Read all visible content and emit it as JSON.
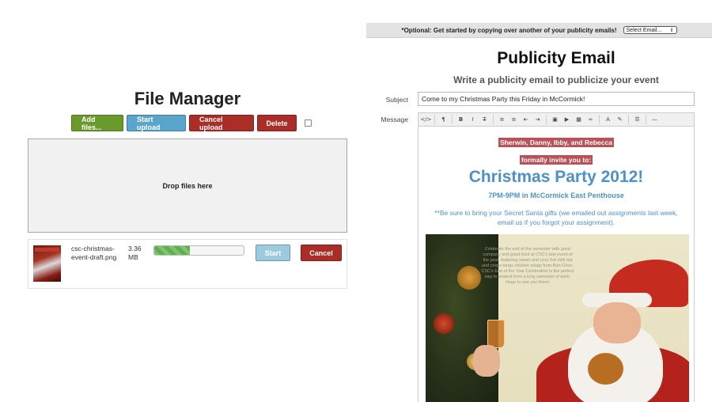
{
  "file_manager": {
    "title": "File Manager",
    "buttons": {
      "add": "Add files...",
      "start_upload": "Start upload",
      "cancel_upload": "Cancel upload",
      "delete": "Delete"
    },
    "dropzone_text": "Drop files here",
    "files": [
      {
        "name": "csc-christmas-event-draft.png",
        "size": "3.36 MB",
        "progress_percent": 40,
        "start_label": "Start",
        "cancel_label": "Cancel"
      }
    ]
  },
  "publicity": {
    "copy_bar": {
      "text": "*Optional: Get started by copying over another of your publicity emails!",
      "select_value": "Select Email..."
    },
    "title": "Publicity Email",
    "subtitle": "Write a publicity email to publicize your event",
    "subject_label": "Subject",
    "subject_value": "Come to my Christmas Party this Friday in McCormick!",
    "message_label": "Message",
    "toolbar_icons": [
      "html-source-icon",
      "paragraph-icon",
      "bold-icon",
      "italic-icon",
      "strikethrough-icon",
      "unordered-list-icon",
      "ordered-list-icon",
      "outdent-icon",
      "indent-icon",
      "image-icon",
      "video-icon",
      "table-icon",
      "link-icon",
      "font-color-icon",
      "background-color-icon",
      "align-icon",
      "horizontal-rule-icon"
    ],
    "editor": {
      "hosts": "Sherwin, Danny, Ibby, and Rebecca",
      "invite_line": "formally invite you to:",
      "heading": "Christmas Party 2012!",
      "when": "7PM-9PM in McCormick East Penthouse",
      "note": "**Be sure to bring your Secret Santa gifts (we emailed out assignments last week, email us if you forgot your assignment).",
      "poster_text": "Celebrate the end of the semester with good company and good food at CSC's last event of the year, featuring sweet and cozy hot milk tea and crispy tangy chicken wings from Bon-Chon. CSC's End of the Year Celebration is the perfect way to unwind from a long semester of work. Hope to see you there!"
    }
  },
  "colors": {
    "green_button": "#6a9a2b",
    "blue_button": "#5aa5cc",
    "red_button": "#ab2d28",
    "accent_blue": "#4d91c9",
    "highlight": "#b95159"
  }
}
